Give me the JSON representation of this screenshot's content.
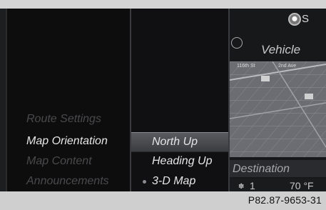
{
  "menu": {
    "items": [
      {
        "label": "Route Settings",
        "active": false
      },
      {
        "label": "Map Orientation",
        "active": true
      },
      {
        "label": "Map Content",
        "active": false
      },
      {
        "label": "Announcements",
        "active": false
      }
    ]
  },
  "orientation_options": [
    {
      "label": "North Up",
      "selected": true
    },
    {
      "label": "Heading Up",
      "selected": false
    },
    {
      "label": "3-D Map",
      "selected": false,
      "bullet": true
    }
  ],
  "right_panel": {
    "header_letter": "S",
    "vehicle_label": "Vehicle",
    "streets": [
      "116th St",
      "2nd Ave"
    ],
    "destination_label": "Destination",
    "fan_level": "1",
    "temperature": "70 °F"
  },
  "footer": {
    "code": "P82.87-9653-31"
  },
  "colors": {
    "selected_bg": "#4b4c50",
    "active_text": "#e8e8e8",
    "inactive_text": "#4a4a4d"
  },
  "icons": [
    "globe-icon",
    "compass-icon",
    "fan-icon",
    "poi-icon"
  ]
}
